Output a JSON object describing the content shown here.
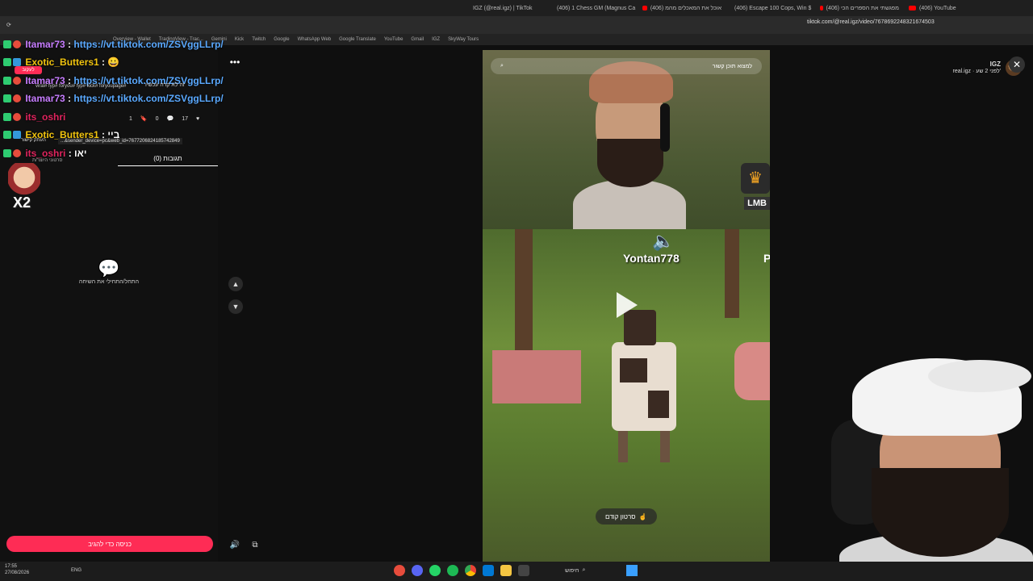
{
  "browser": {
    "tabs": [
      {
        "label": "IGZ (@real.igz) | TikTok",
        "active": true
      },
      {
        "label": "(406) 1 Chess GM (Magnus Ca"
      },
      {
        "label": "(406) אוכל את המאכלים מהמ"
      },
      {
        "label": "(406) Escape 100 Cops, Win $"
      },
      {
        "label": "(406) מפגשתי את הספרים הכי"
      },
      {
        "label": "(406) YouTube"
      }
    ],
    "url": "tiktok.com/@real.igz/video/7678692248321674503",
    "bookmarks": [
      "TradingView - Trac...",
      "Gemini",
      "Kick",
      "Twitch",
      "Google",
      "WhatsApp Web",
      "Google Translate",
      "YouTube",
      "Gmail",
      "IGZ",
      "SkyWay Tours",
      "Overview - Wallet"
    ]
  },
  "chat": [
    {
      "user": "Itamar73",
      "text": "https://vt.tiktok.com/ZSVggLLrp/",
      "user_color": "u1"
    },
    {
      "user": "Exotic_Butters1",
      "text": "😀",
      "user_color": "u2"
    },
    {
      "user": "Itamar73",
      "text": "https://vt.tiktok.com/ZSVggLLrp/",
      "user_color": "u1"
    },
    {
      "user": "Itamar73",
      "text": "https://vt.tiktok.com/ZSVggLLrp/",
      "user_color": "u1"
    },
    {
      "user": "its_oshri",
      "text": "",
      "user_color": "u3"
    },
    {
      "user": "Exotic_Butters1",
      "text": "ביי",
      "user_color": "u2"
    },
    {
      "user": "its_oshri",
      "text": "יאו",
      "user_color": "u3"
    }
  ],
  "post": {
    "author": "IGZ",
    "handle": "real.igz · לפני 2 שע'",
    "caption": "זה לא קרה עכשיו",
    "follow_label": "לעקוב",
    "tags": "viral# fyp# foryou# fyp# kick# foryoupage#",
    "link": "...&sender_device=pc&web_id=7677206824185742849",
    "copy_link": "העתק קישור",
    "likes": "17",
    "comments_count": "0",
    "saves": "1",
    "comments_tab": "תגובות (0)",
    "creator_videos_tab": "סרטוני היוצר/ת",
    "empty_comments": "התחל/התחילי את השיחה",
    "add_comment": "כניסה כדי להגיב"
  },
  "video": {
    "search_placeholder": "למצוא תוכן קשור",
    "player_name": "Yontan778",
    "player_name2": "P",
    "lmb_label": "LMB",
    "next_video": "סרטון קודם"
  },
  "taskbar": {
    "time": "17:55",
    "date": "27/08/2026",
    "lang": "ENG",
    "search_label": "חיפוש"
  },
  "colors": {
    "accent": "#fe2c55",
    "link": "#5aa9ff"
  }
}
